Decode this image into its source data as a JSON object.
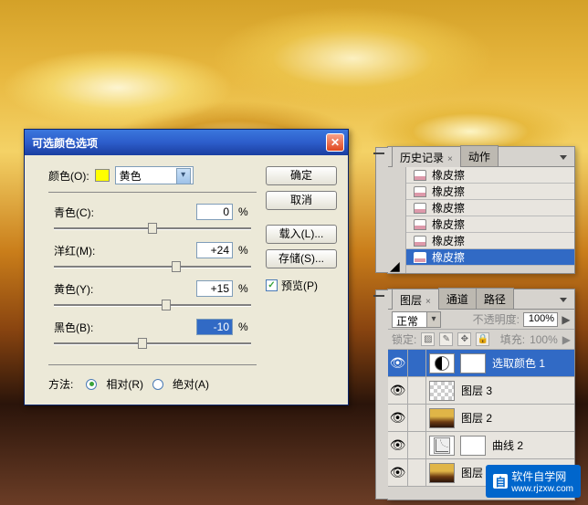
{
  "dialog": {
    "title": "可选颜色选项",
    "color_label": "颜色(O):",
    "color_value": "黄色",
    "sliders": {
      "cyan": {
        "label": "青色(C):",
        "value": "0",
        "pos": 50
      },
      "magenta": {
        "label": "洋红(M):",
        "value": "+24",
        "pos": 62
      },
      "yellow": {
        "label": "黄色(Y):",
        "value": "+15",
        "pos": 57
      },
      "black": {
        "label": "黑色(B):",
        "value": "-10",
        "pos": 45
      }
    },
    "percent": "%",
    "method_label": "方法:",
    "method_relative": "相对(R)",
    "method_absolute": "绝对(A)",
    "buttons": {
      "ok": "确定",
      "cancel": "取消",
      "load": "载入(L)...",
      "save": "存储(S)..."
    },
    "preview": "预览(P)"
  },
  "history": {
    "tab_history": "历史记录",
    "tab_actions": "动作",
    "item": "橡皮擦"
  },
  "layers": {
    "tab_layers": "图层",
    "tab_channels": "通道",
    "tab_paths": "路径",
    "blend": "正常",
    "opacity_label": "不透明度:",
    "opacity_value": "100%",
    "lock_label": "锁定:",
    "fill_label": "填充:",
    "fill_value": "100%",
    "items": {
      "selcolor": "选取颜色 1",
      "l3": "图层 3",
      "l2": "图层 2",
      "curves": "曲线 2",
      "l1": "图层"
    }
  },
  "watermark": {
    "brand": "软件自学网",
    "url": "www.rjzxw.com",
    "badge": "自"
  }
}
